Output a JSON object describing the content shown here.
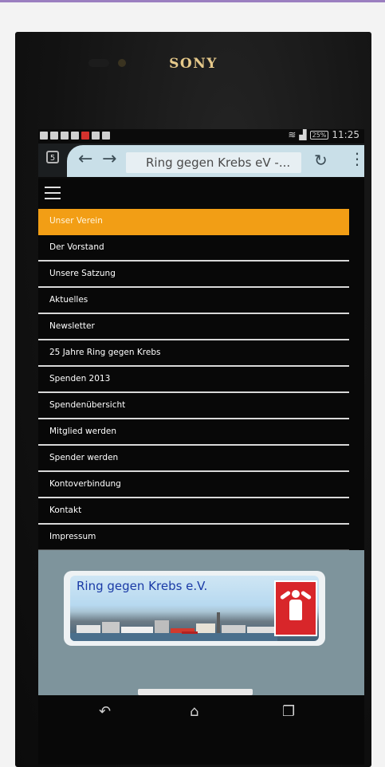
{
  "device": {
    "brand": "SONY"
  },
  "status_bar": {
    "battery": "25%",
    "time": "11:25"
  },
  "browser": {
    "tab_count": "5",
    "back_icon": "arrow-left-icon",
    "forward_icon": "arrow-right-icon",
    "url_title": "Ring gegen Krebs eV -...",
    "reload_icon": "reload-icon",
    "more_icon": "more-vert-icon"
  },
  "site": {
    "menu_icon": "hamburger-icon",
    "menu": [
      {
        "label": "Unser Verein",
        "active": true
      },
      {
        "label": "Der Vorstand"
      },
      {
        "label": "Unsere Satzung"
      },
      {
        "label": "Aktuelles"
      },
      {
        "label": "Newsletter"
      },
      {
        "label": "25 Jahre Ring gegen Krebs"
      },
      {
        "label": "Spenden 2013"
      },
      {
        "label": "Spendenübersicht"
      },
      {
        "label": "Mitglied werden"
      },
      {
        "label": "Spender werden"
      },
      {
        "label": "Kontoverbindung"
      },
      {
        "label": "Kontakt"
      },
      {
        "label": "Impressum"
      }
    ],
    "banner_title": "Ring gegen Krebs e.V.",
    "accent_color": "#f29e15",
    "logo_color": "#d8262a"
  },
  "android_nav": {
    "back_icon": "back-icon",
    "home_icon": "home-icon",
    "recents_icon": "recents-icon"
  }
}
